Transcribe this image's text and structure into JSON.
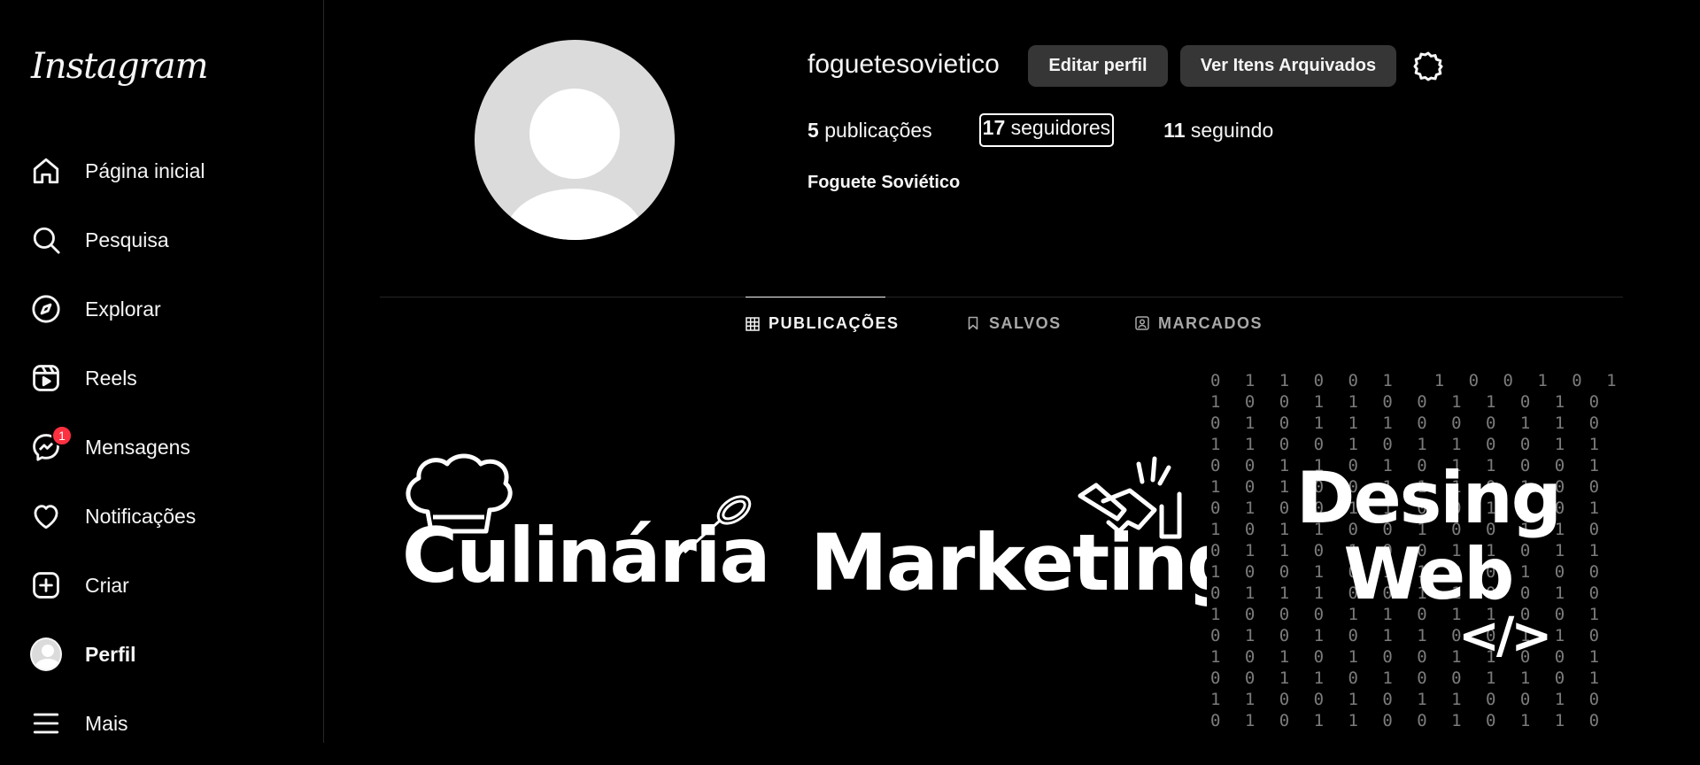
{
  "app": {
    "logo_text": "Instagram"
  },
  "sidebar": {
    "items": [
      {
        "label": "Página inicial",
        "icon": "home-icon"
      },
      {
        "label": "Pesquisa",
        "icon": "search-icon"
      },
      {
        "label": "Explorar",
        "icon": "compass-icon"
      },
      {
        "label": "Reels",
        "icon": "reels-icon"
      },
      {
        "label": "Mensagens",
        "icon": "messenger-icon",
        "badge": "1"
      },
      {
        "label": "Notificações",
        "icon": "heart-icon"
      },
      {
        "label": "Criar",
        "icon": "plus-square-icon"
      },
      {
        "label": "Perfil",
        "icon": "avatar"
      },
      {
        "label": "Mais",
        "icon": "menu-icon"
      }
    ]
  },
  "profile": {
    "username": "foguetesovietico",
    "edit_label": "Editar perfil",
    "archive_label": "Ver Itens Arquivados",
    "posts_count": "5",
    "posts_label": "publicações",
    "followers_count": "17",
    "followers_label": "seguidores",
    "following_count": "11",
    "following_label": "seguindo",
    "full_name": "Foguete Soviético"
  },
  "tabs": [
    {
      "label": "PUBLICAÇÕES",
      "active": true,
      "icon": "grid-icon"
    },
    {
      "label": "SALVOS",
      "active": false,
      "icon": "bookmark-icon"
    },
    {
      "label": "MARCADOS",
      "active": false,
      "icon": "tagged-icon"
    }
  ],
  "posts": [
    {
      "title": "Culinária"
    },
    {
      "title": "Marketing"
    },
    {
      "title_line1": "Desing",
      "title_line2": "Web",
      "code_symbol": "</>"
    }
  ],
  "colors": {
    "background": "#000000",
    "text": "#f5f5f5",
    "button": "#363636",
    "badge": "#ff3040",
    "muted": "#a8a8a8"
  }
}
